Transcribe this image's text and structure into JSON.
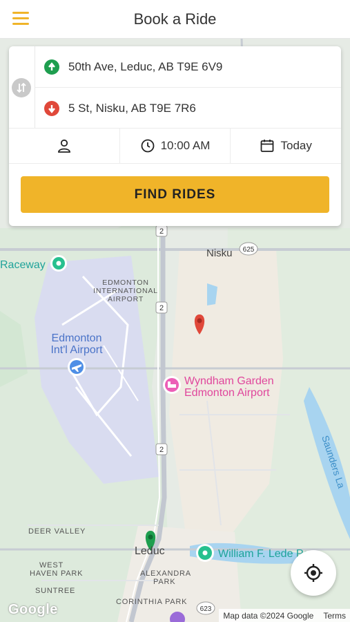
{
  "header": {
    "title": "Book a Ride",
    "menu_icon": "hamburger-icon"
  },
  "booking": {
    "origin": "50th Ave, Leduc, AB T9E 6V9",
    "destination": "5 St, Nisku, AB T9E 7R6",
    "time": "10:00 AM",
    "date": "Today",
    "button": "FIND RIDES"
  },
  "map": {
    "labels": {
      "raceway": "Raceway",
      "nisku": "Nisku",
      "airport_label_1": "EDMONTON",
      "airport_label_2": "INTERNATIONAL",
      "airport_label_3": "AIRPORT",
      "airport_name_1": "Edmonton",
      "airport_name_2": "Int'l Airport",
      "hotel_1": "Wyndham Garden",
      "hotel_2": "Edmonton Airport",
      "deer_valley": "DEER VALLEY",
      "leduc": "Leduc",
      "west_haven_1": "WEST",
      "west_haven_2": "HAVEN PARK",
      "alexandra_1": "ALEXANDRA",
      "alexandra_2": "PARK",
      "suntree": "SUNTREE",
      "corinthia": "CORINTHIA PARK",
      "william": "William F. Lede Pa",
      "saunders": "Saunders La",
      "hwy_2": "2",
      "hwy_625": "625",
      "hwy_623": "623"
    },
    "google_logo": "Google",
    "attribution": "Map data ©2024 Google",
    "terms": "Terms"
  },
  "colors": {
    "accent": "#f0b429",
    "origin": "#1e9e4f",
    "destination": "#e0483a"
  }
}
